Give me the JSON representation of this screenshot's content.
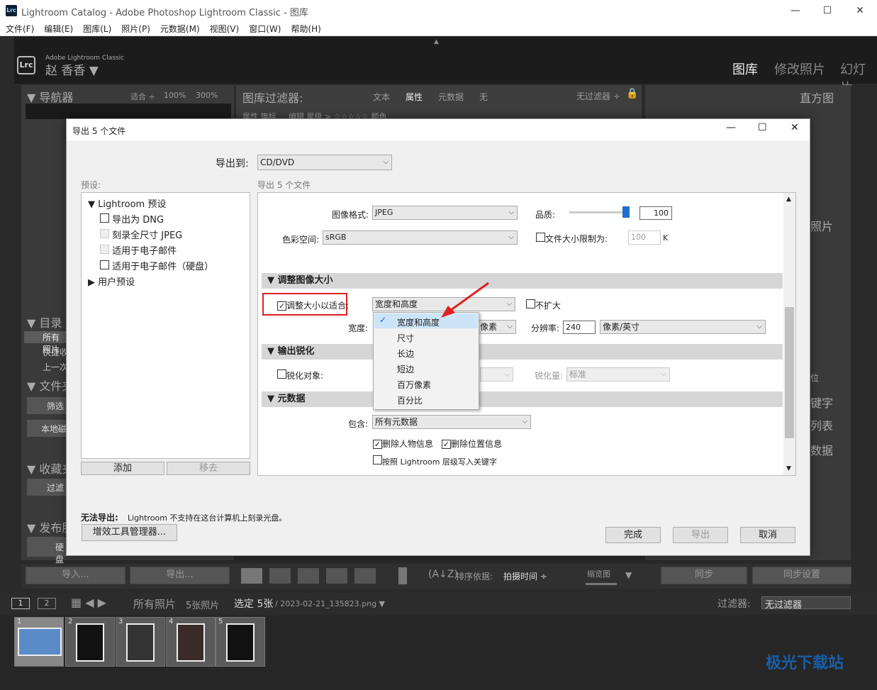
{
  "window": {
    "app_icon": "Lrc",
    "title": "Lightroom Catalog - Adobe Photoshop Lightroom Classic - 图库",
    "minimize": "—",
    "maximize": "☐",
    "close": "✕"
  },
  "menu": [
    "文件(F)",
    "编辑(E)",
    "图库(L)",
    "照片(P)",
    "元数据(M)",
    "视图(V)",
    "窗口(W)",
    "帮助(H)"
  ],
  "identity": {
    "logo": "Lrc",
    "app_name": "Adobe Lightroom Classic",
    "user": "赵 香香 ▼"
  },
  "modules": [
    "图库",
    "修改照片",
    "幻灯片"
  ],
  "navigator": {
    "title": "导航器",
    "fit": "适合 ÷",
    "zoom100": "100%",
    "zoom300": "300%"
  },
  "filter_bar": {
    "title": "图库过滤器:",
    "tabs": [
      "文本",
      "属性",
      "元数据",
      "无"
    ],
    "preset": "无过滤器 ÷",
    "row": "属性  旗标  ... 编辑  星级  > ☆☆☆☆☆  颜色"
  },
  "histogram": {
    "title": "直方图"
  },
  "left_panels": {
    "catalog": "目录",
    "catalog_items": [
      "所有照片",
      "快捷收",
      "上一次"
    ],
    "folders": "文件夹",
    "filter": "筛选",
    "local": "本地磁",
    "collections": "收藏夹",
    "collections_filter": "过滤",
    "publish": "发布服",
    "publish_item": "硬盘"
  },
  "right_panels": {
    "photo": "照片",
    "keywords": "键字",
    "list": "列表",
    "metadata": "数据",
    "loc": "位"
  },
  "bottom_buttons": {
    "import": "导入...",
    "export": "导出...",
    "sync": "同步",
    "sync_settings": "同步设置",
    "sort_label": "排序依据:",
    "sort_value": "拍摄时间 ÷",
    "thumbnail": "缩览图"
  },
  "filmstrip_bar": {
    "page1": "1",
    "page2": "2",
    "source": "所有照片",
    "count": "5张照片",
    "selected": "选定 5张",
    "filename": "/ 2023-02-21_135823.png ▼",
    "filter_label": "过滤器:",
    "filter_value": "无过滤器"
  },
  "thumbnails": [
    "1",
    "2",
    "3",
    "4",
    "5"
  ],
  "dialog": {
    "title": "导出 5 个文件",
    "export_to_label": "导出到:",
    "export_to_value": "CD/DVD",
    "presets_label": "预设:",
    "content_label": "导出 5 个文件",
    "preset_tree": {
      "group": "Lightroom 预设",
      "items": [
        "导出为 DNG",
        "刻录全尺寸 JPEG",
        "适用于电子邮件",
        "适用于电子邮件（硬盘）"
      ],
      "user_group": "用户预设"
    },
    "add_button": "添加",
    "remove_button": "移去",
    "format_label": "图像格式:",
    "format_value": "JPEG",
    "quality_label": "品质:",
    "quality_value": "100",
    "quality_level": 1.0,
    "colorspace_label": "色彩空间:",
    "colorspace_value": "sRGB",
    "limit_label": "文件大小限制为:",
    "limit_value": "100",
    "limit_unit": "K",
    "resize_section": "调整图像大小",
    "resize_checkbox": "调整大小以适合:",
    "resize_value": "宽度和高度",
    "no_enlarge": "不扩大",
    "width_label": "宽度:",
    "width_unit": "像素",
    "resolution_label": "分辨率:",
    "resolution_value": "240",
    "resolution_unit": "像素/英寸",
    "dropdown_options": [
      "宽度和高度",
      "尺寸",
      "长边",
      "短边",
      "百万像素",
      "百分比"
    ],
    "sharpen_section": "输出锐化",
    "sharpen_checkbox": "锐化对象:",
    "sharpen_amount_label": "锐化量:",
    "sharpen_amount_value": "标准",
    "metadata_section": "元数据",
    "include_label": "包含:",
    "include_value": "所有元数据",
    "remove_person": "删除人物信息",
    "remove_location": "删除位置信息",
    "hierarchy": "按照 Lightroom 层级写入关键字",
    "error_label": "无法导出:",
    "error_text": "Lightroom 不支持在这台计算机上刻录光盘。",
    "plugin_button": "增效工具管理器...",
    "done_button": "完成",
    "export_button": "导出",
    "cancel_button": "取消"
  },
  "watermark": "极光下载站",
  "colors": {
    "highlight_box": "#e02020",
    "arrow": "#e02020",
    "selected_item": "#cce4f7"
  }
}
